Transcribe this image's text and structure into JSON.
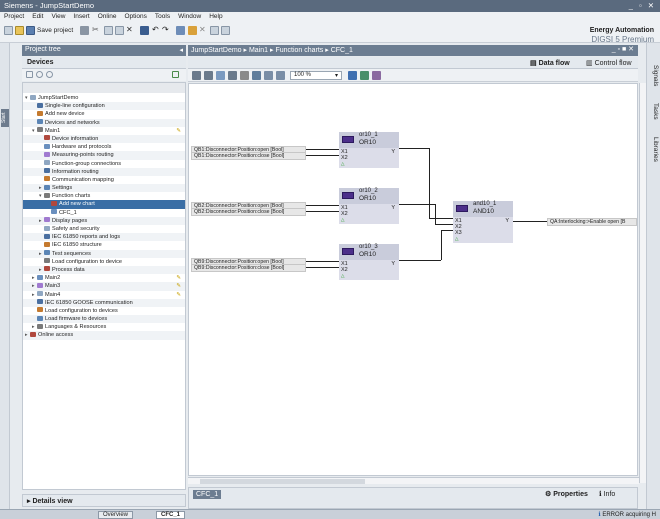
{
  "window": {
    "title": "Siemens - JumpStartDemo",
    "controls": "_ ▫ ✕"
  },
  "menu": [
    "Project",
    "Edit",
    "View",
    "Insert",
    "Online",
    "Options",
    "Tools",
    "Window",
    "Help"
  ],
  "toolbar": {
    "save_label": "Save project",
    "brand_line1": "Energy Automation",
    "brand_line2": "DIGSI 5 Premium"
  },
  "left_strip": {
    "start_label": "Start"
  },
  "project_tree": {
    "header": "Project tree",
    "devices_tab": "Devices",
    "items": [
      {
        "label": "JumpStartDemo",
        "indent": 0,
        "toggle": "▾"
      },
      {
        "label": "Single-line configuration",
        "indent": 1
      },
      {
        "label": "Add new device",
        "indent": 1
      },
      {
        "label": "Devices and networks",
        "indent": 1
      },
      {
        "label": "Main1",
        "indent": 1,
        "toggle": "▾",
        "pen": true
      },
      {
        "label": "Device information",
        "indent": 2
      },
      {
        "label": "Hardware and protocols",
        "indent": 2
      },
      {
        "label": "Measuring-points routing",
        "indent": 2
      },
      {
        "label": "Function-group connections",
        "indent": 2
      },
      {
        "label": "Information routing",
        "indent": 2
      },
      {
        "label": "Communication mapping",
        "indent": 2
      },
      {
        "label": "Settings",
        "indent": 2,
        "toggle": "▸"
      },
      {
        "label": "Function charts",
        "indent": 2,
        "toggle": "▾"
      },
      {
        "label": "Add new chart",
        "indent": 3,
        "selected": true
      },
      {
        "label": "CFC_1",
        "indent": 3
      },
      {
        "label": "Display pages",
        "indent": 2,
        "toggle": "▸"
      },
      {
        "label": "Safety and security",
        "indent": 2
      },
      {
        "label": "IEC 61850 reports and logs",
        "indent": 2
      },
      {
        "label": "IEC 61850 structure",
        "indent": 2
      },
      {
        "label": "Test sequences",
        "indent": 2,
        "toggle": "▸"
      },
      {
        "label": "Load configuration to device",
        "indent": 2
      },
      {
        "label": "Process data",
        "indent": 2,
        "toggle": "▸"
      },
      {
        "label": "Main2",
        "indent": 1,
        "toggle": "▸",
        "pen": true
      },
      {
        "label": "Main3",
        "indent": 1,
        "toggle": "▸",
        "pen": true
      },
      {
        "label": "Main4",
        "indent": 1,
        "toggle": "▸",
        "pen": true
      },
      {
        "label": "IEC 61850 GOOSE communication",
        "indent": 1
      },
      {
        "label": "Load configuration to devices",
        "indent": 1
      },
      {
        "label": "Load firmware to devices",
        "indent": 1
      },
      {
        "label": "Languages & Resources",
        "indent": 1,
        "toggle": "▸"
      },
      {
        "label": "Online access",
        "indent": 0,
        "toggle": "▸"
      }
    ],
    "details_label": "Details view"
  },
  "editor": {
    "breadcrumb": "JumpStartDemo  ▸  Main1  ▸  Function charts  ▸  CFC_1",
    "tab_data_flow": "Data flow",
    "tab_control_flow": "Control flow",
    "zoom": "100 %",
    "blocks": [
      {
        "name": "or10_1",
        "type": "OR10",
        "inputs": [
          "X1",
          "X2"
        ],
        "output": "Y",
        "signals": [
          "QB1:Disconnector:Position:open [Bool]",
          "QB1:Disconnector:Position:close [Bool]"
        ]
      },
      {
        "name": "or10_2",
        "type": "OR10",
        "inputs": [
          "X1",
          "X2"
        ],
        "output": "Y",
        "signals": [
          "QB2:Disconnector:Position:open [Bool]",
          "QB2:Disconnector:Position:close [Bool]"
        ]
      },
      {
        "name": "or10_3",
        "type": "OR10",
        "inputs": [
          "X1",
          "X2"
        ],
        "output": "Y",
        "signals": [
          "QB9:Disconnector:Position:open [Bool]",
          "QB9:Disconnector:Position:close [Bool]"
        ]
      },
      {
        "name": "and10_1",
        "type": "AND10",
        "inputs": [
          "X1",
          "X2",
          "X3"
        ],
        "output": "Y",
        "signals": [
          "QA:Interlocking:>Enable open [B"
        ]
      }
    ]
  },
  "bottom_panel": {
    "tab": "CFC_1",
    "properties": "Properties",
    "info": "Info"
  },
  "right_tabs": [
    "Signals",
    "Tasks",
    "Libraries"
  ],
  "taskbar": {
    "overview": "Overview",
    "cfc": "CFC_1",
    "status": "ERROR acquiring H"
  }
}
